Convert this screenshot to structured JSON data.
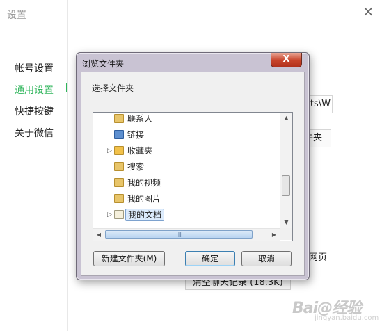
{
  "window": {
    "title": "设置",
    "close_glyph": "×"
  },
  "sidebar": {
    "items": [
      {
        "label": "帐号设置",
        "active": false
      },
      {
        "label": "通用设置",
        "active": true
      },
      {
        "label": "快捷按键",
        "active": false
      },
      {
        "label": "关于微信",
        "active": false
      }
    ],
    "accent_color": "#2fb55b"
  },
  "background_fields": {
    "path_fragment": "nts\\W",
    "folder_button_fragment": "件夹",
    "webpage_fragment": "网页",
    "clear_history_label": "清空聊天记录 (18.3K)"
  },
  "dialog": {
    "title": "浏览文件夹",
    "close_glyph": "X",
    "description": "选择文件夹",
    "tree": [
      {
        "label": "联系人",
        "icon": "contacts-folder-icon",
        "expandable": false,
        "selected": false
      },
      {
        "label": "链接",
        "icon": "links-folder-icon",
        "expandable": false,
        "selected": false
      },
      {
        "label": "收藏夹",
        "icon": "favorites-folder-icon",
        "expandable": true,
        "selected": false
      },
      {
        "label": "搜索",
        "icon": "search-folder-icon",
        "expandable": false,
        "selected": false
      },
      {
        "label": "我的视频",
        "icon": "videos-folder-icon",
        "expandable": false,
        "selected": false
      },
      {
        "label": "我的图片",
        "icon": "pictures-folder-icon",
        "expandable": false,
        "selected": false
      },
      {
        "label": "我的文档",
        "icon": "documents-folder-icon",
        "expandable": true,
        "selected": true
      }
    ],
    "buttons": {
      "new_folder": "新建文件夹(M)",
      "ok": "确定",
      "cancel": "取消"
    }
  },
  "watermark": {
    "text": "Bai@经验",
    "sub": "jingyan.baidu.com"
  }
}
